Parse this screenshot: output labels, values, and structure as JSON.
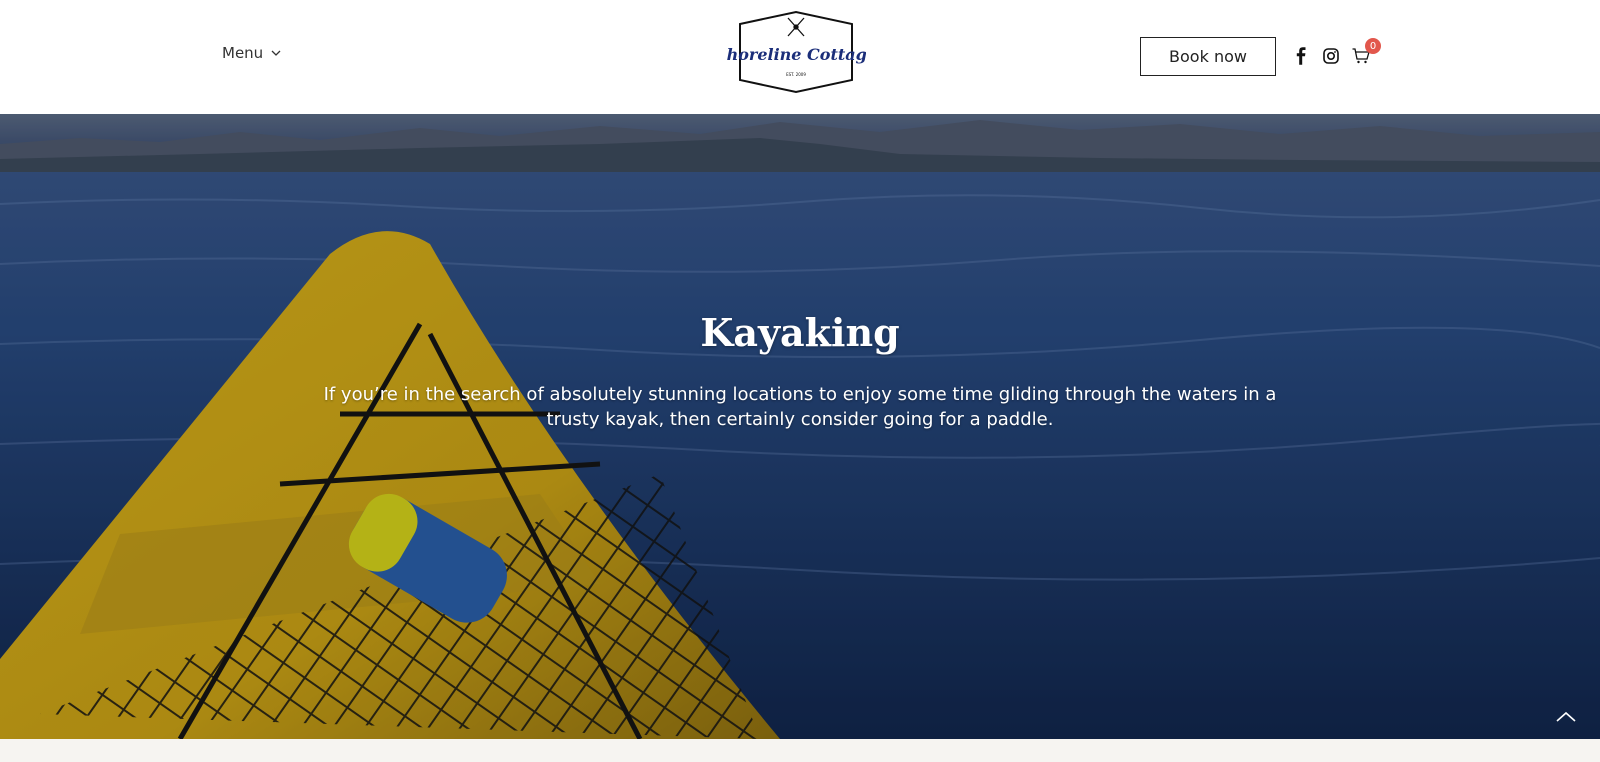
{
  "header": {
    "menu_label": "Menu",
    "logo": {
      "name": "Shoreline Cottage",
      "est": "EST. 2009",
      "icon": "crossed-paddles-icon"
    },
    "book_label": "Book now",
    "social": [
      "facebook-icon",
      "instagram-icon"
    ],
    "cart": {
      "icon": "cart-icon",
      "count": "0"
    }
  },
  "hero": {
    "title": "Kayaking",
    "text": "If you’re in the search of absolutely stunning locations to enjoy some time gliding through the waters in a trusty kayak, then certainly consider going for a paddle.",
    "scroll_top_icon": "chevron-up-icon"
  },
  "colors": {
    "badge": "#e2574c",
    "water": "#1f3a66",
    "kayak": "#e6c21a"
  }
}
